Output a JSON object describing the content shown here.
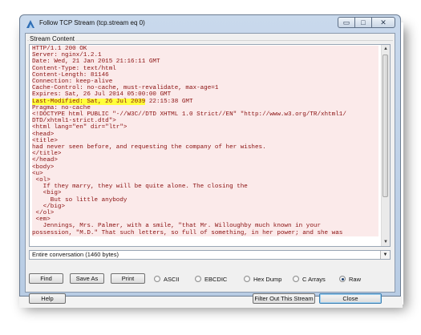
{
  "window": {
    "title": "Follow TCP Stream (tcp.stream eq 0)",
    "minimize_glyph": "▭",
    "maximize_glyph": "□",
    "close_glyph": "✕"
  },
  "stream_content": {
    "group_label": "Stream Content",
    "lines_before": [
      "HTTP/1.1 200 OK",
      "Server: nginx/1.2.1",
      "Date: Wed, 21 Jan 2015 21:16:11 GMT",
      "Content-Type: text/html",
      "Content-Length: 81146",
      "Connection: keep-alive",
      "Cache-Control: no-cache, must-revalidate, max-age=1",
      "Expires: Sat, 26 Jul 2014 05:00:00 GMT"
    ],
    "highlighted_line_hl": "Last-Modified: Sat, 26 Jul 2039",
    "highlighted_line_rest": " 22:15:38 GMT",
    "lines_after": [
      "Pragma: no-cache",
      "",
      "<!DOCTYPE html PUBLIC \"-//W3C//DTD XHTML 1.0 Strict//EN\" \"http://www.w3.org/TR/xhtml1/",
      "DTD/xhtml1-strict.dtd\">",
      "<html lang=\"en\" dir=\"ltr\">",
      "<head>",
      "",
      "<title>",
      "had never seen before, and requesting the company of her wishes.",
      "</title>",
      "</head>",
      "<body>",
      "<u>",
      " <ol>",
      "   If they marry, they will be quite alone. The closing the",
      "   <big>",
      "     But so little anybody",
      "   </big>",
      " </ol>",
      " <em>",
      "   Jennings, Mrs. Palmer, with a smile, \"that Mr. Willoughby much known in your",
      "possession, \"M.D.\" That such letters, so full of something, in her power; and she was"
    ]
  },
  "conversation_select": {
    "value": "Entire conversation (1460 bytes)"
  },
  "buttons": {
    "find": "Find",
    "save_as": "Save As",
    "print": "Print",
    "help": "Help",
    "filter_out": "Filter Out This Stream",
    "close": "Close"
  },
  "radios": [
    {
      "label": "ASCII",
      "selected": false
    },
    {
      "label": "EBCDIC",
      "selected": false
    },
    {
      "label": "Hex Dump",
      "selected": false
    },
    {
      "label": "C Arrays",
      "selected": false
    },
    {
      "label": "Raw",
      "selected": true
    }
  ],
  "background": {
    "strip_text": "..."
  },
  "colors": {
    "stream_text": "#8a1010",
    "stream_bg": "#fbeaea",
    "highlight": "#ffff3a"
  }
}
